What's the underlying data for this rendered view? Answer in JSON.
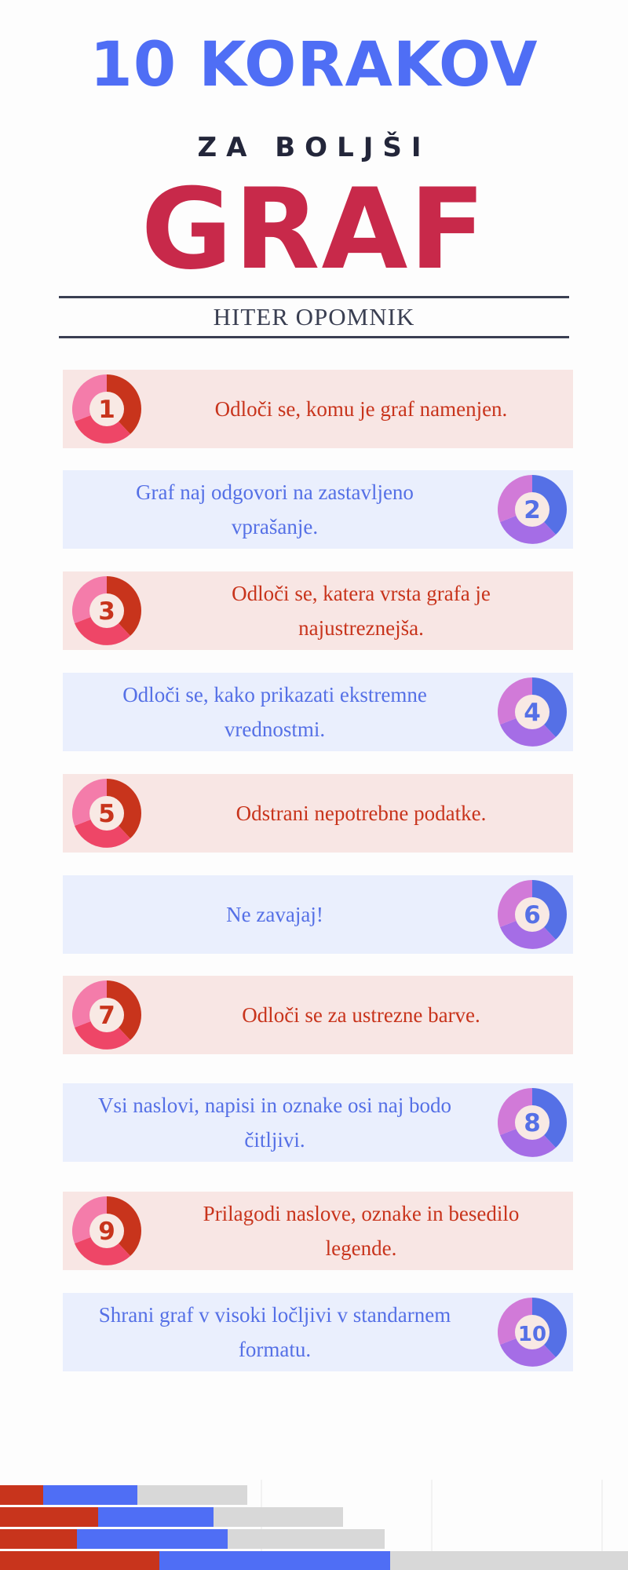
{
  "header": {
    "title_line1": "10 KORAKOV",
    "title_line2": "ZA BOLJŠI",
    "title_line3": "GRAF",
    "subtitle": "HITER OPOMNIK"
  },
  "colors": {
    "blue": "#4f6ef5",
    "crimson": "#c8294a",
    "red_text": "#c8341c",
    "blue_text": "#5570e6",
    "red_card": "#f8e6e4",
    "blue_card": "#eaeffd"
  },
  "steps": [
    {
      "num": "1",
      "text": "Odloči se, komu je graf namenjen."
    },
    {
      "num": "2",
      "text": "Graf naj odgovori na zastavljeno vprašanje."
    },
    {
      "num": "3",
      "text": "Odloči se, katera vrsta grafa je najustreznejša."
    },
    {
      "num": "4",
      "text": "Odloči se, kako prikazati ekstremne vrednostmi."
    },
    {
      "num": "5",
      "text": "Odstrani nepotrebne podatke."
    },
    {
      "num": "6",
      "text": "Ne zavajaj!"
    },
    {
      "num": "7",
      "text": "Odloči se za ustrezne barve."
    },
    {
      "num": "8",
      "text": "Vsi naslovi, napisi in oznake osi naj bodo čitljivi."
    },
    {
      "num": "9",
      "text": "Prilagodi naslove, oznake in besedilo legende."
    },
    {
      "num": "10",
      "text": "Shrani graf v visoki ločljivi v standarnem formatu."
    }
  ],
  "decor_bars": [
    {
      "red": 55,
      "blue": 175,
      "gray": 315
    },
    {
      "red": 125,
      "blue": 272,
      "gray": 437
    },
    {
      "red": 98,
      "blue": 290,
      "gray": 490
    },
    {
      "red": 203,
      "blue": 497,
      "gray": 800
    }
  ]
}
